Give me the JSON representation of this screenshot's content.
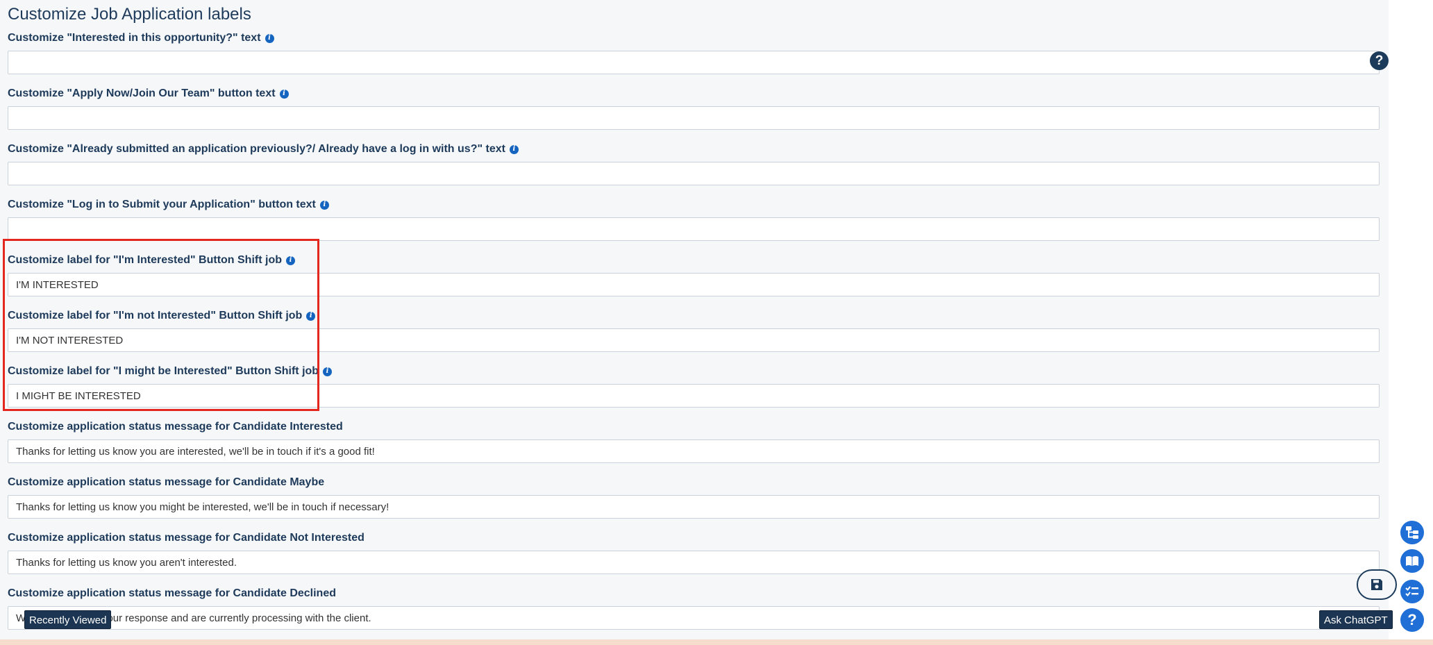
{
  "page": {
    "title": "Customize Job Application labels"
  },
  "fields": [
    {
      "label": "Customize \"Interested in this opportunity?\" text",
      "value": "",
      "has_info": true
    },
    {
      "label": "Customize \"Apply Now/Join Our Team\" button text",
      "value": "",
      "has_info": true
    },
    {
      "label": "Customize \"Already submitted an application previously?/ Already have a log in with us?\" text",
      "value": "",
      "has_info": true
    },
    {
      "label": "Customize \"Log in to Submit your Application\" button text",
      "value": "",
      "has_info": true
    },
    {
      "label": "Customize label for \"I'm Interested\" Button Shift job",
      "value": "I'M INTERESTED",
      "has_info": true
    },
    {
      "label": "Customize label for \"I'm not Interested\" Button Shift job",
      "value": "I'M NOT INTERESTED",
      "has_info": true
    },
    {
      "label": "Customize label for \"I might be Interested\" Button Shift job",
      "value": "I MIGHT BE INTERESTED",
      "has_info": true
    },
    {
      "label": "Customize application status message for Candidate Interested",
      "value": "Thanks for letting us know you are interested, we'll be in touch if it's a good fit!",
      "has_info": false
    },
    {
      "label": "Customize application status message for Candidate Maybe",
      "value": "Thanks for letting us know you might be interested, we'll be in touch if necessary!",
      "has_info": false
    },
    {
      "label": "Customize application status message for Candidate Not Interested",
      "value": "Thanks for letting us know you aren't interested.",
      "has_info": false
    },
    {
      "label": "Customize application status message for Candidate Declined",
      "value": "We have received your response and are currently processing with the client.",
      "has_info": false
    }
  ],
  "info_icon": {
    "glyph": "i",
    "icon": "info-icon",
    "color": "#1565c0"
  },
  "help": {
    "glyph": "?",
    "icon": "question-circle-icon"
  },
  "floating_actions": [
    {
      "icon": "org-chart-icon"
    },
    {
      "icon": "open-book-icon"
    },
    {
      "icon": "checklist-icon"
    },
    {
      "icon": "help-icon",
      "glyph": "?"
    }
  ],
  "save_button": {
    "icon": "save-icon"
  },
  "bottom_bar": {
    "recently_viewed_label": "Recently Viewed",
    "ask_chatgpt_label": "Ask ChatGPT"
  },
  "colors": {
    "accent": "#1f6fd6",
    "label": "#1e3a5a",
    "highlight": "#e3261e",
    "dark_navy": "#1c3553"
  }
}
